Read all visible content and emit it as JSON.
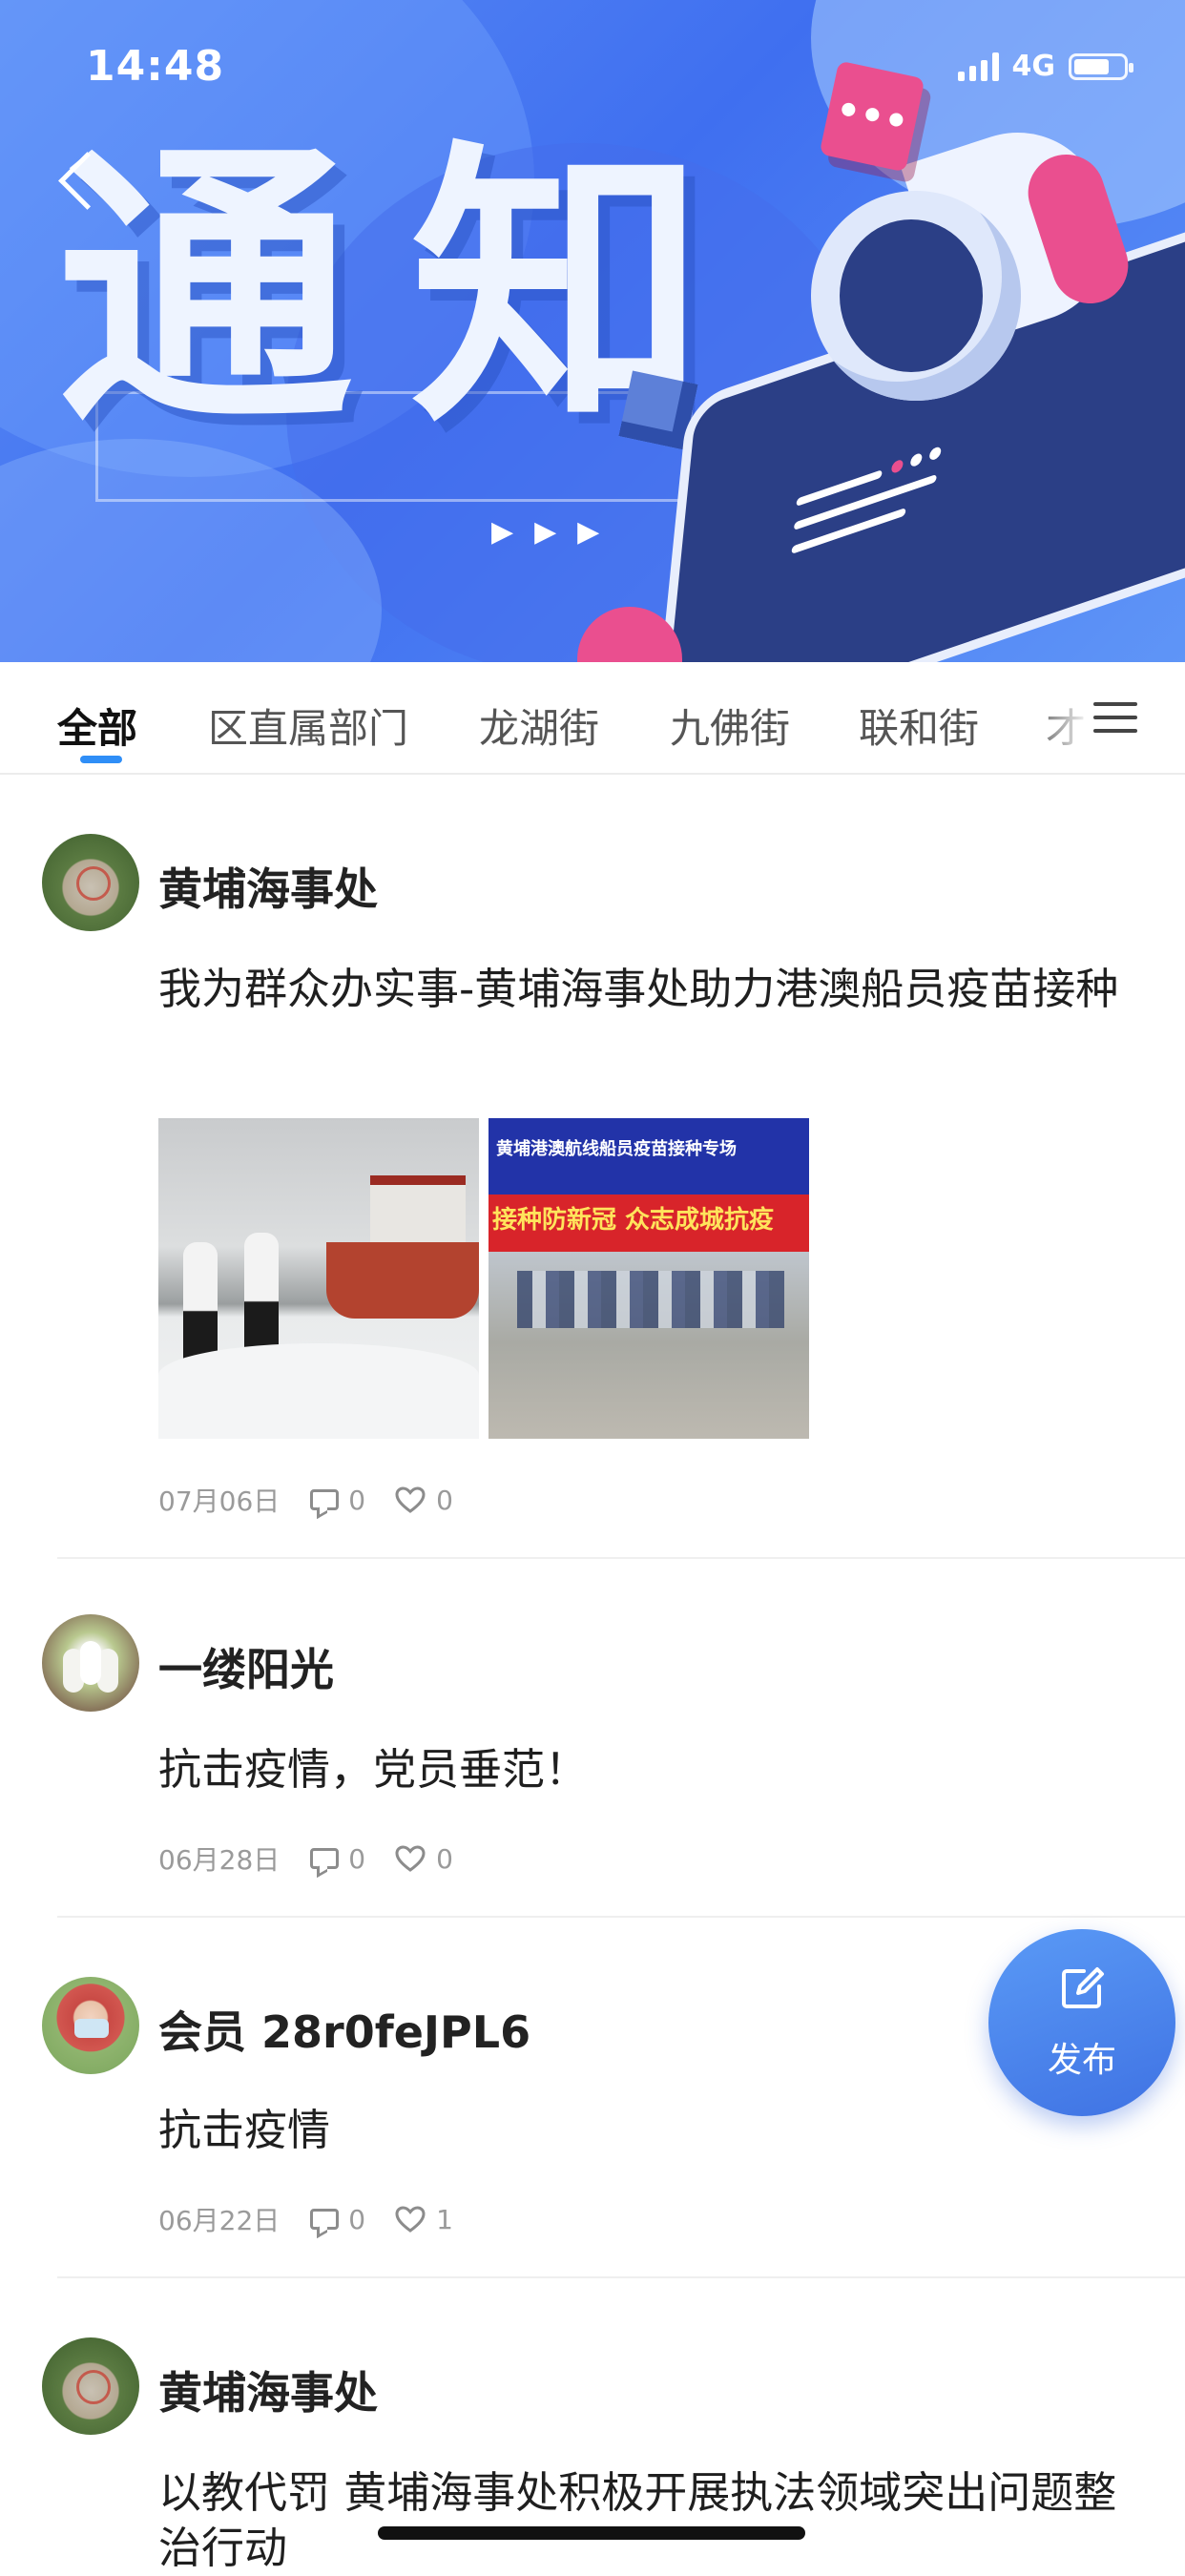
{
  "status_bar": {
    "time": "14:48",
    "network": "4G"
  },
  "banner": {
    "title": "通知",
    "back_icon": "chevron-left-icon"
  },
  "tabs": [
    {
      "label": "全部",
      "active": true
    },
    {
      "label": "区直属部门",
      "active": false
    },
    {
      "label": "龙湖街",
      "active": false
    },
    {
      "label": "九佛街",
      "active": false
    },
    {
      "label": "联和街",
      "active": false
    },
    {
      "label": "才",
      "active": false
    }
  ],
  "menu_icon": "menu-icon",
  "posts": [
    {
      "author": "黄埔海事处",
      "avatar": "stone-avatar",
      "text": "我为群众办实事-黄埔海事处助力港澳船员疫苗接种",
      "images": [
        {
          "name": "photo-ship-crew"
        },
        {
          "name": "photo-vaccination-tent",
          "banner_title": "黄埔港澳航线船员疫苗接种专场",
          "banner_slogan": "接种防新冠 众志成城抗疫"
        }
      ],
      "date": "07月06日",
      "comments": "0",
      "likes": "0"
    },
    {
      "author": "一缕阳光",
      "avatar": "flower-avatar",
      "text": "抗击疫情，党员垂范！",
      "date": "06月28日",
      "comments": "0",
      "likes": "0"
    },
    {
      "author": "会员 28r0feJPL6",
      "avatar": "person-avatar",
      "text": "抗击疫情",
      "date": "06月22日",
      "comments": "0",
      "likes": "1"
    },
    {
      "author": "黄埔海事处",
      "avatar": "stone-avatar",
      "text": "以教代罚 黄埔海事处积极开展执法领域突出问题整治行动"
    }
  ],
  "fab": {
    "label": "发布",
    "icon": "edit-icon"
  },
  "colors": {
    "accent": "#2f8ef7",
    "fab": "#4a82ec",
    "banner": "#4a78f2",
    "meta_text": "#9a9a9a"
  }
}
